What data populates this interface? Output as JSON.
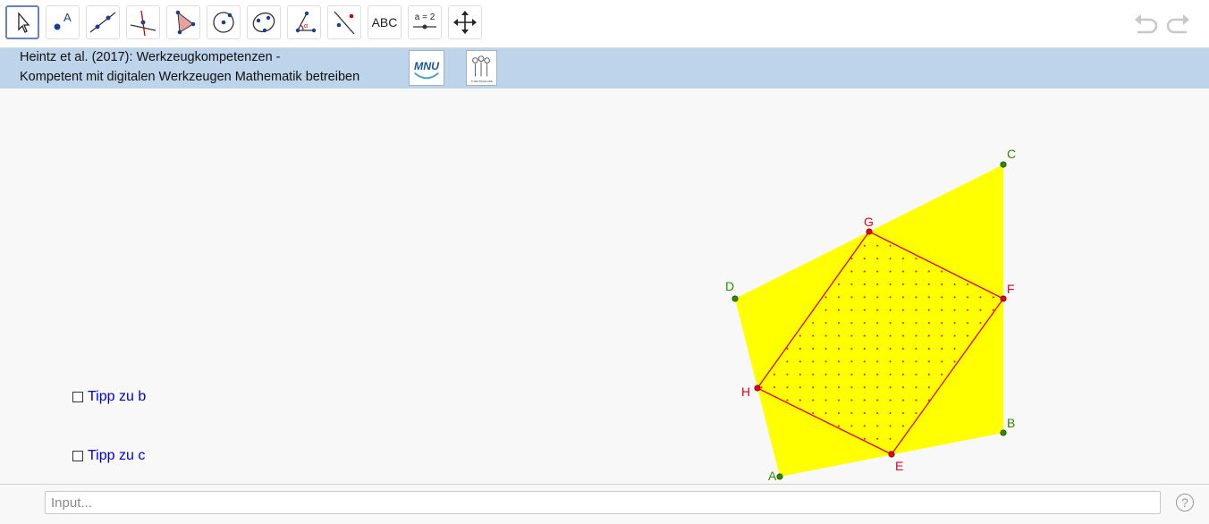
{
  "toolbar": {
    "text_tool_label": "ABC",
    "slider_tool_label": "a = 2"
  },
  "banner": {
    "line1": "Heintz et al. (2017): Werkzeugkompetenzen -",
    "line2": "Kompetent mit digitalen Werkzeugen Mathematik betreiben",
    "logo1_text": "MNU",
    "logo2_text": "T³ DEUTSCHLAND"
  },
  "checkboxes": [
    {
      "label": "Tipp zu b",
      "checked": false
    },
    {
      "label": "Tipp zu c",
      "checked": false
    }
  ],
  "points": {
    "outer": [
      "A",
      "B",
      "C",
      "D"
    ],
    "inner": [
      "E",
      "F",
      "G",
      "H"
    ]
  },
  "colors": {
    "outer_fill": "#ffff00",
    "outer_points": "#2e8b00",
    "inner_lines": "#e3001b",
    "toolbar_selected": "#6b7fc7",
    "banner_bg": "#bdd4ea",
    "checkbox_label": "#0000cc"
  },
  "input": {
    "placeholder": "Input..."
  },
  "help_label": "?"
}
